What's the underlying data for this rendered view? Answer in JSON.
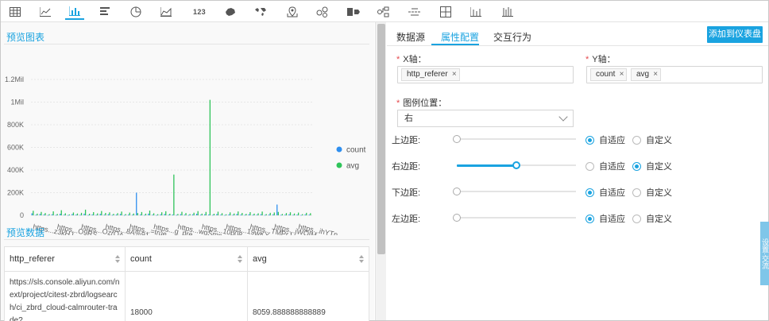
{
  "toolbar": {
    "icons": [
      "table-icon",
      "line-chart-icon",
      "bar-chart-icon",
      "horizontal-bar-icon",
      "pie-chart-icon",
      "area-chart-icon",
      "number-icon",
      "map-china-icon",
      "map-world-icon",
      "location-map-icon",
      "flow-chart-icon",
      "funnel-icon",
      "tree-icon",
      "word-cloud-icon",
      "board-icon",
      "histogram-icon",
      "column-icon"
    ],
    "number_label": "123",
    "active": "bar-chart-icon"
  },
  "preview_chart": {
    "title": "预览图表"
  },
  "preview_data": {
    "title": "预览数据",
    "columns": [
      "http_referer",
      "count",
      "avg"
    ],
    "rows": [
      {
        "http_referer": "https://sls.console.aliyun.com/next/project/citest-zbrd/logsearch/ci_zbrd_cloud-calmrouter-trade?",
        "count": "18000",
        "avg": "8059.888888888889"
      }
    ]
  },
  "chart_data": {
    "type": "bar",
    "title": "",
    "xlabel": "",
    "ylabel": "",
    "ylim": [
      0,
      1200000
    ],
    "yticks": [
      "0",
      "200K",
      "400K",
      "600K",
      "800K",
      "1Mil",
      "1.2Mil"
    ],
    "xticks": [
      "https...z3kHJ",
      "https...O9RS",
      "https...OzrQA",
      "https...8A%91",
      "https...=true",
      "https...g_pre",
      "https...wgSmp",
      "https...10b08",
      "https...19wKY",
      "https...TMPrJ",
      "https...jWQIM",
      "https...ihYTn"
    ],
    "legend_position": "right",
    "series": [
      {
        "name": "count",
        "color": "#2f8fef",
        "values": [
          18000,
          5000,
          12000,
          8000,
          3000,
          9000,
          4000,
          14000,
          6000,
          2500,
          11000,
          7000,
          4500,
          15000,
          3500,
          8000,
          5000,
          13000,
          6000,
          9500,
          4000,
          7000,
          12000,
          3000,
          6500,
          5000,
          200000,
          8000,
          4000,
          15000,
          6000,
          3000,
          9000,
          12000,
          5000,
          7000,
          4000,
          10000,
          6000,
          3500,
          8000,
          14000,
          5000,
          9000,
          7000,
          4000,
          11000,
          6000,
          3000,
          8000,
          5000,
          12000,
          7000,
          4500,
          9000,
          5000,
          6000,
          10000,
          3500,
          7000,
          8000,
          95000,
          4000,
          6000,
          9000,
          5000,
          7000,
          3000,
          8000,
          6000
        ]
      },
      {
        "name": "avg",
        "color": "#2fc45a",
        "values": [
          40000,
          15000,
          30000,
          20000,
          10000,
          35000,
          12000,
          45000,
          18000,
          8000,
          25000,
          16000,
          22000,
          50000,
          14000,
          28000,
          17000,
          38000,
          21000,
          26000,
          13000,
          19000,
          33000,
          11000,
          24000,
          16000,
          20000,
          29000,
          15000,
          42000,
          18000,
          10000,
          27000,
          36000,
          14000,
          360000,
          12000,
          31000,
          20000,
          11000,
          23000,
          37000,
          15000,
          30000,
          1020000,
          14000,
          32000,
          19000,
          9000,
          26000,
          16000,
          34000,
          21000,
          13000,
          28000,
          15000,
          18000,
          33000,
          11000,
          22000,
          25000,
          30000,
          12000,
          20000,
          27000,
          16000,
          24000,
          10000,
          22000,
          19000
        ]
      }
    ]
  },
  "config": {
    "tabs": [
      "数据源",
      "属性配置",
      "交互行为"
    ],
    "active_tab": "属性配置",
    "add_button": "添加到仪表盘",
    "x_axis": {
      "label": "X轴：",
      "tags": [
        "http_referer"
      ]
    },
    "y_axis": {
      "label": "Y轴：",
      "tags": [
        "count",
        "avg"
      ]
    },
    "legend_position": {
      "label": "图例位置：",
      "value": "右"
    },
    "margins": [
      {
        "label": "上边距:",
        "mode": "auto",
        "level": 0
      },
      {
        "label": "右边距:",
        "mode": "custom",
        "level": 0.5
      },
      {
        "label": "下边距:",
        "mode": "auto",
        "level": 0
      },
      {
        "label": "左边距:",
        "mode": "auto",
        "level": 0
      }
    ],
    "auto_label": "自适应",
    "custom_label": "自定义"
  },
  "side_float": {
    "text": "设置·交流"
  },
  "accent_color": "#1aa3e0"
}
